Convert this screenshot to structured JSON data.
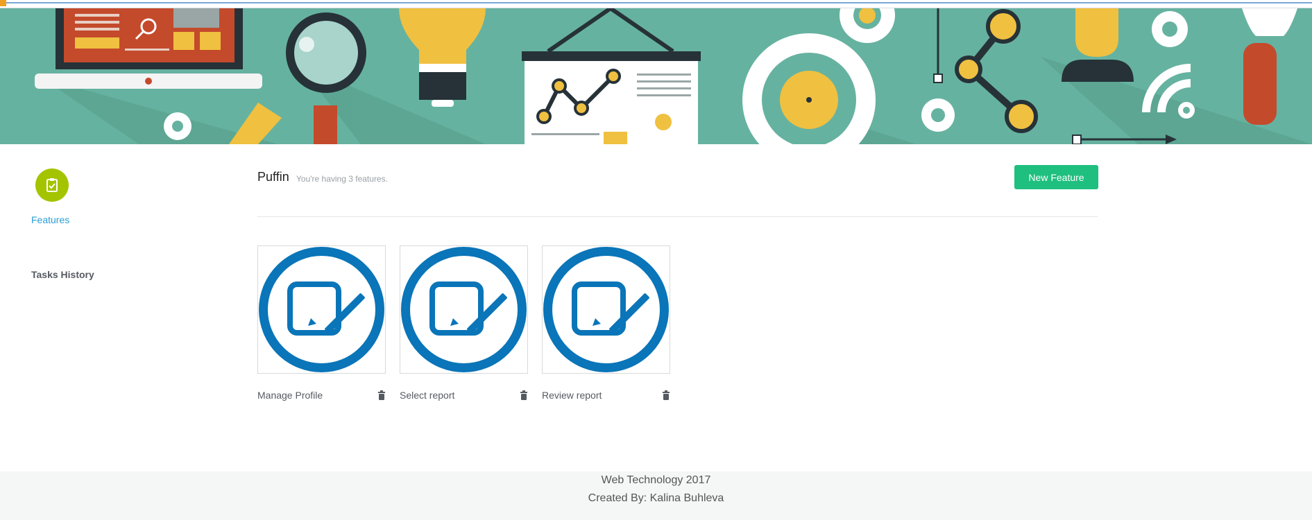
{
  "sidebar": {
    "features_label": "Features",
    "features_icon": "clipboard-check-icon",
    "tasks_history_label": "Tasks History"
  },
  "header": {
    "title": "Puffin",
    "subtitle": "You're having 3 features.",
    "new_feature_label": "New Feature"
  },
  "features": [
    {
      "name": "Manage Profile",
      "icon": "edit-icon",
      "delete_icon": "trash-icon"
    },
    {
      "name": "Select report",
      "icon": "edit-icon",
      "delete_icon": "trash-icon"
    },
    {
      "name": "Review report",
      "icon": "edit-icon",
      "delete_icon": "trash-icon"
    }
  ],
  "footer": {
    "line1": "Web Technology 2017",
    "line2": "Created By: Kalina Buhleva"
  },
  "colors": {
    "banner": "#66b2a0",
    "accent_green": "#1fbf7f",
    "feature_circle": "#a4c400",
    "link_blue": "#2a9fd6",
    "icon_blue": "#0a75b8"
  }
}
